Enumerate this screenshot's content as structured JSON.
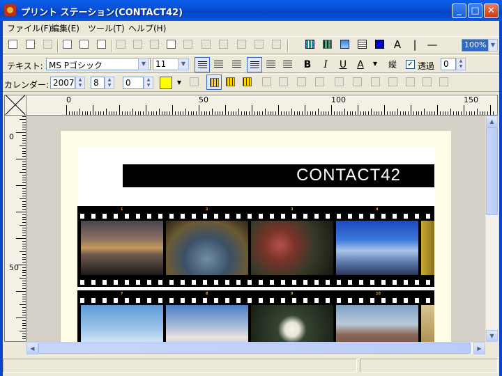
{
  "window": {
    "title": "プリント ステーション(CONTACT42)"
  },
  "menu": {
    "items": [
      "ファイル(F)",
      "編集(E)",
      "ツール(T)",
      "ヘルプ(H)"
    ]
  },
  "zoom": "100%",
  "text_toolbar": {
    "label": "テキスト:",
    "font": "MS Pゴシック",
    "size": "11",
    "bold": "B",
    "italic": "I",
    "underline": "U",
    "color_letter": "A",
    "vertical": "縦",
    "transparent_label": "透過",
    "transparent_checked": "✓",
    "transparent_value": "0"
  },
  "calendar_toolbar": {
    "label": "カレンダー:",
    "year": "2007",
    "month": "8",
    "offset": "0",
    "color": "#ffff00"
  },
  "tools": {
    "text_tool": "A",
    "vline_tool": "|",
    "hline_tool": "—"
  },
  "ruler": {
    "h_labels": [
      "0",
      "50",
      "100",
      "150"
    ],
    "v_labels": [
      "0",
      "50"
    ]
  },
  "document": {
    "title": "CONTACT42",
    "row1_numbers": [
      "1",
      "2",
      "3",
      "4"
    ],
    "row2_numbers": [
      "7",
      "8",
      "9",
      "10"
    ]
  }
}
